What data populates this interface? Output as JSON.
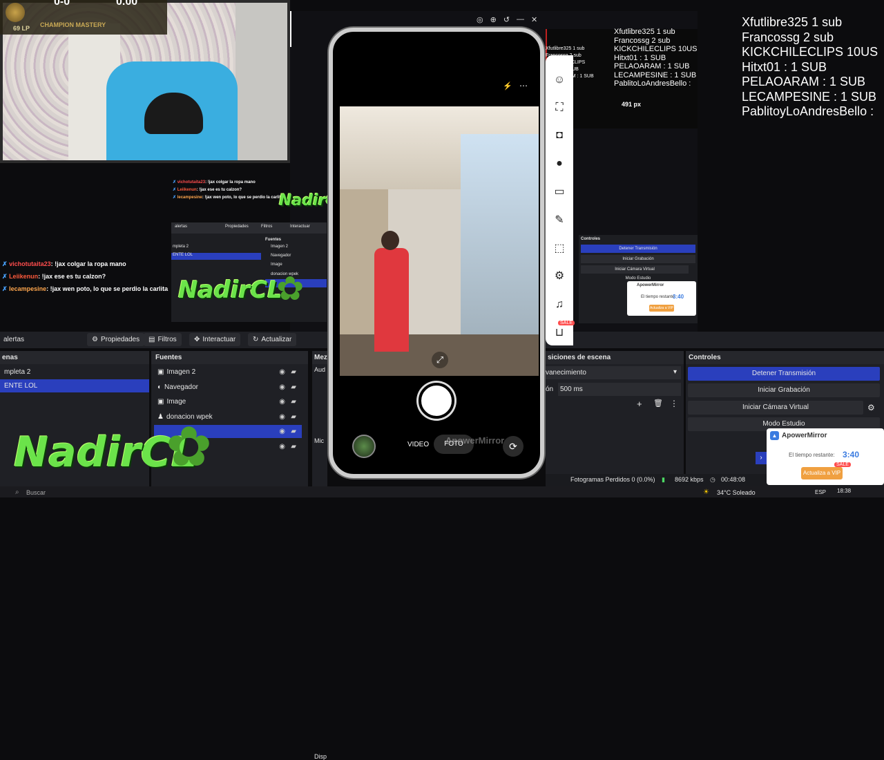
{
  "overlay": {
    "lp": "69 LP",
    "mastery": "CHAMPION MASTERY",
    "score_left": "0-0",
    "score_right": "0.00",
    "logo_text": "NadirCL"
  },
  "subs_big": [
    "Xfutlibre325 1 sub",
    "Francossg 2 sub",
    "KICKCHILECLIPS 10US",
    "Hitxt01 : 1 SUB",
    "PELAOARAM : 1 SUB",
    "LECAMPESINE : 1 SUB",
    "PablitoyLoAndresBello :"
  ],
  "subs_small": [
    "Xfutlibre325 1 sub",
    "Francossg 2 sub",
    "KICKCHILECLIPS 10US",
    "Hitxt01 : 1 SUB",
    "PELAOARAM : 1 SUB",
    "LECAMPESINE : 1 SUB",
    "PablitoLoAndresBello :"
  ],
  "subs_tiny": [
    "Xfutlibre325 1 sub",
    "Francossg 2 sub",
    "KICKCHILECLIPS",
    "Hitxt01 : 1 SUB",
    "PELAOARAM : 1 SUB"
  ],
  "px_label": "491 px",
  "chat": [
    {
      "user": "vichotutaita23",
      "msg": ": !jax colgar la ropa mano"
    },
    {
      "user": "Leiikenun",
      "msg": ": !jax ese es tu calzon?"
    },
    {
      "user": "lecampesine",
      "msg": ": !jax wen poto, lo que se perdio la carlita"
    }
  ],
  "obs": {
    "scene_label": "alertas",
    "toolbar": {
      "properties": "Propiedades",
      "filters": "Filtros",
      "interact": "Interactuar",
      "refresh": "Actualizar"
    },
    "scenes": {
      "header": "enas",
      "items": [
        "mpleta 2",
        "ENTE LOL"
      ]
    },
    "sources": {
      "header": "Fuentes",
      "items": [
        "Imagen 2",
        "Navegador",
        "Image",
        "donacion wpek",
        "",
        ""
      ]
    },
    "mixer": {
      "header": "Mez",
      "items": [
        "Aud",
        "Disp",
        "Mic"
      ]
    },
    "transitions": {
      "header": "siciones de escena",
      "effect": "vanecimiento",
      "duration_label": "ón",
      "duration": "500 ms"
    },
    "controls": {
      "header": "Controles",
      "stop_stream": "Detener Transmisión",
      "start_record": "Iniciar Grabación",
      "virtual_cam": "Iniciar Cámara Virtual",
      "studio_mode": "Modo Estudio"
    },
    "status": {
      "dropped": "Fotogramas Perdidos 0 (0.0%)",
      "bitrate": "8692 kbps",
      "time": "00:48:08"
    }
  },
  "mini_obs": {
    "label": "alertas",
    "properties": "Propiedades",
    "filters": "Filtros",
    "interact": "Interactuar",
    "controls": "Controles",
    "stop_stream": "Detener Transmisión",
    "start_record": "Iniciar Grabación",
    "virtual_cam": "Iniciar Cámara Virtual",
    "studio_mode": "Modo Estudio",
    "sources_header": "Fuentes",
    "sources": [
      "Imagen 2",
      "Navegador",
      "Image",
      "donacion wpek"
    ],
    "scene": "mpleta 2",
    "scene_sel": "ENTE LOL"
  },
  "phone": {
    "mode_video": "VIDEO",
    "mode_foto": "FOTO",
    "watermark": "ApowerMirror"
  },
  "trial": {
    "title": "ApowerMirror",
    "remaining": "El tiempo restante:",
    "time": "3:40",
    "button": "Actualiza a VIP",
    "sale": "SALE"
  },
  "side_sale": "SALE",
  "taskbar": {
    "search": "Buscar",
    "weather": "34°C Soleado",
    "lang": "ESP",
    "clock": "18:38"
  },
  "colors": {
    "accent": "#2a3fbd",
    "logo_green": "#6be34a",
    "apower_blue": "#3a7be0"
  }
}
